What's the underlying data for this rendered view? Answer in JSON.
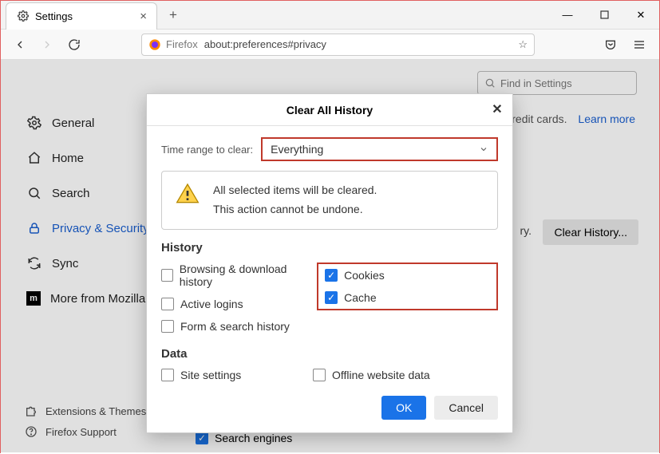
{
  "titlebar": {
    "tab_title": "Settings"
  },
  "toolbar": {
    "url_scheme": "Firefox",
    "url": "about:preferences#privacy"
  },
  "page": {
    "find_placeholder": "Find in Settings",
    "credit_text": "credit cards.",
    "learn_more": "Learn more",
    "clear_history_btn": "Clear History...",
    "ry_suffix": "ry."
  },
  "sidebar": {
    "items": [
      {
        "label": "General"
      },
      {
        "label": "Home"
      },
      {
        "label": "Search"
      },
      {
        "label": "Privacy & Security"
      },
      {
        "label": "Sync"
      },
      {
        "label": "More from Mozilla"
      }
    ],
    "bottom": [
      {
        "label": "Extensions & Themes"
      },
      {
        "label": "Firefox Support"
      }
    ]
  },
  "dialog": {
    "title": "Clear All History",
    "time_range_label": "Time range to clear:",
    "time_range_value": "Everything",
    "warn_line1": "All selected items will be cleared.",
    "warn_line2": "This action cannot be undone.",
    "section_history": "History",
    "section_data": "Data",
    "checks": {
      "browsing": "Browsing & download history",
      "active_logins": "Active logins",
      "form_search": "Form & search history",
      "cookies": "Cookies",
      "cache": "Cache",
      "site_settings": "Site settings",
      "offline": "Offline website data"
    },
    "ok": "OK",
    "cancel": "Cancel"
  },
  "search_engines_label": "Search engines"
}
